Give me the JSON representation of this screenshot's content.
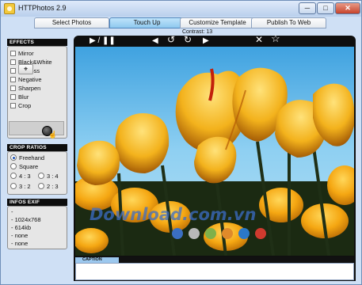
{
  "window": {
    "title": "HTTPhotos 2.9",
    "min": "─",
    "max": "□",
    "close": "✕"
  },
  "tabs": [
    {
      "label": "Select Photos"
    },
    {
      "label": "Touch Up"
    },
    {
      "label": "Customize Template"
    },
    {
      "label": "Publish To Web"
    }
  ],
  "active_tab": "Touch Up",
  "status": {
    "contrast": "Contrast: 13"
  },
  "effects": {
    "title": "EFFECTS",
    "items": [
      "Mirror",
      "Black&White",
      "Emboss",
      "Negative",
      "Sharpen",
      "Blur",
      "Crop"
    ]
  },
  "crop_ratios": {
    "title": "CROP RATIOS",
    "options": [
      "Freehand",
      "Square",
      "4 : 3",
      "3 : 4",
      "3 : 2",
      "2 : 3"
    ],
    "selected": "Freehand"
  },
  "exif": {
    "title": "INFOS EXIF",
    "lines": [
      "-",
      "- 1024x768",
      "- 614kb",
      "- none",
      "- none"
    ]
  },
  "toolbar": {
    "play_pause": "▶ / ❚❚",
    "prev": "◀",
    "rotate_left": "↺",
    "rotate_right": "↻",
    "next": "▶",
    "delete": "✕",
    "favorite": "☆"
  },
  "watermark": {
    "text": "Download.com.vn",
    "dot_colors": [
      "#3b6fc2",
      "#b9b9b9",
      "#7fb04a",
      "#e08a2a",
      "#2b78c8",
      "#cf3a2e"
    ]
  },
  "caption": {
    "label": "CAPTION",
    "value": ""
  },
  "colors": {
    "accent_tab": "#8fc9ef",
    "panel_header": "#0d0d0d",
    "photo_sky": "#5fb8ea"
  }
}
